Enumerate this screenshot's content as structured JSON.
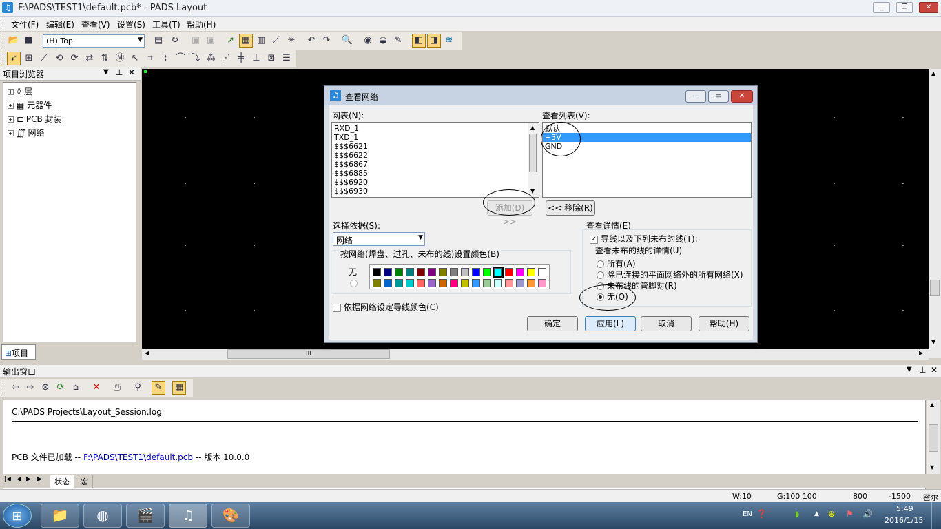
{
  "window": {
    "title": "F:\\PADS\\TEST1\\default.pcb* - PADS Layout",
    "icon": "pads-icon"
  },
  "menu": [
    "文件(F)",
    "编辑(E)",
    "查看(V)",
    "设置(S)",
    "工具(T)",
    "帮助(H)"
  ],
  "toolbar": {
    "layer_select": "(H) Top"
  },
  "project_browser": {
    "title": "项目浏览器",
    "items": [
      "层",
      "元器件",
      "PCB 封装",
      "网络"
    ],
    "tab": "项目"
  },
  "dialog": {
    "title": "查看网络",
    "net_list_label": "网表(N):",
    "net_list": [
      "RXD_1",
      "TXD_1",
      "$$$6621",
      "$$$6622",
      "$$$6867",
      "$$$6885",
      "$$$6920",
      "$$$6930"
    ],
    "view_list_label": "查看列表(V):",
    "view_list": [
      "默认",
      "+3V",
      "GND"
    ],
    "view_list_selected": 1,
    "add_button": "添加(D) >>",
    "remove_button": "<< 移除(R)",
    "select_by_label": "选择依据(S):",
    "select_by_value": "网络",
    "color_group_label": "按网络(焊盘、过孔、未布的线)设置颜色(B)",
    "color_none_label": "无",
    "colors_row1": [
      "#000000",
      "#000080",
      "#008000",
      "#008080",
      "#800000",
      "#800080",
      "#808000",
      "#808080",
      "#c0c0c0",
      "#0000ff",
      "#00ff00",
      "#00ffff",
      "#ff0000",
      "#ff00ff",
      "#ffff00",
      "#ffffff"
    ],
    "colors_row2": [
      "#808000",
      "#0066cc",
      "#009999",
      "#00cccc",
      "#ff6666",
      "#9966cc",
      "#cc6600",
      "#ff0080",
      "#c0c000",
      "#3399ff",
      "#99cc99",
      "#ccffff",
      "#ff9999",
      "#9999cc",
      "#ff9933",
      "#ff99cc"
    ],
    "trace_color_check": "依据网络设定导线颜色(C)",
    "details_label": "查看详情(E)",
    "details_check": "导线以及下列未布的线(T):",
    "unrouted_label": "查看未布的线的详情(U)",
    "radio_options": [
      "所有(A)",
      "除已连接的平面网络外的所有网络(X)",
      "未布线的管脚对(R)",
      "无(O)"
    ],
    "radio_selected": 3,
    "buttons": {
      "ok": "确定",
      "apply": "应用(L)",
      "cancel": "取消",
      "help": "帮助(H)"
    }
  },
  "output": {
    "title": "输出窗口",
    "line1": "C:\\PADS Projects\\Layout_Session.log",
    "line2_prefix": "PCB 文件已加载  --",
    "line2_link": "F:\\PADS\\TEST1\\default.pcb",
    "line2_suffix": "--  版本  10.0.0",
    "tabs": [
      "状态",
      "宏"
    ]
  },
  "status": {
    "w": "W:10",
    "g": "G:100 100",
    "x": "800",
    "y": "-1500",
    "unit": "密尔"
  },
  "taskbar": {
    "lang": "EN",
    "time": "5:49",
    "date": "2016/1/15"
  }
}
